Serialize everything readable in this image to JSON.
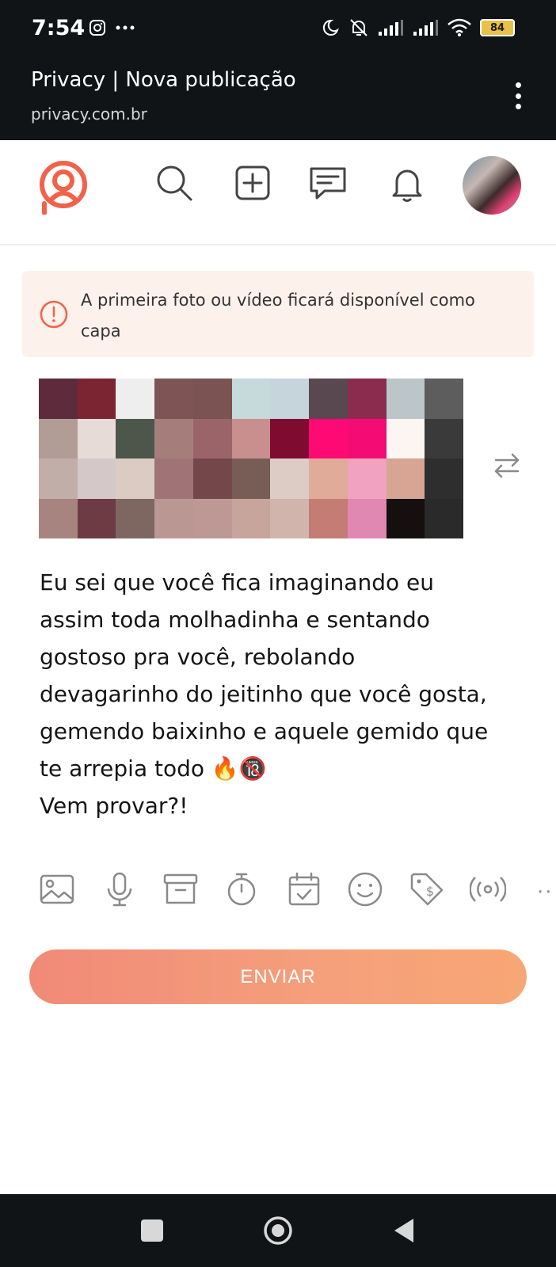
{
  "status_bar": {
    "time": "7:54",
    "battery": "84",
    "icons": [
      "instagram-icon",
      "more-dots-icon",
      "moon-icon",
      "bell-off-icon",
      "signal-icon",
      "signal-icon",
      "wifi-icon",
      "battery-icon"
    ]
  },
  "browser": {
    "title": "Privacy | Nova publicação",
    "url": "privacy.com.br",
    "menu_icon": "more-vertical-icon"
  },
  "header": {
    "logo_icon": "privacy-logo",
    "nav_icons": [
      "search-icon",
      "add-post-icon",
      "messages-icon",
      "notifications-icon"
    ],
    "avatar": "profile-avatar"
  },
  "notice": {
    "icon": "alert-circle-icon",
    "text": "A primeira foto ou vídeo ficará disponível como capa"
  },
  "media": {
    "swap_icon": "swap-arrows-icon",
    "colors": [
      "#5e2b3c",
      "#7a2531",
      "#eeeeee",
      "#7e5554",
      "#7b5352",
      "#c7dadb",
      "#c6d5db",
      "#5a4850",
      "#8b2c4e",
      "#bcc5c8",
      "#5d5d5d",
      "#b19c96",
      "#e6dbd6",
      "#4d564b",
      "#a57e7c",
      "#9a6468",
      "#c98f8f",
      "#7f0b31",
      "#ff0a74",
      "#f40c74",
      "#fbf6f2",
      "#3a3a3a",
      "#c2aea8",
      "#d4c9c8",
      "#dbcbc2",
      "#a07377",
      "#74484a",
      "#785c56",
      "#ddccc6",
      "#e1ab9a",
      "#f0a2c0",
      "#d8a594",
      "#2e2e2e",
      "#a7847f",
      "#6d3b44",
      "#7e6761",
      "#bb9794",
      "#bd9894",
      "#c7a49c",
      "#d1b4ab",
      "#c47c74",
      "#e087b2",
      "#150f10",
      "#2a2a2a"
    ]
  },
  "post": {
    "lines": [
      "Eu sei que você fica imaginando eu",
      "assim toda molhadinha e sentando",
      "gostoso pra você, rebolando",
      "devagarinho do jeitinho que você gosta,",
      "gemendo baixinho e aquele gemido que",
      "te arrepia todo 🔥🔞",
      "Vem provar?!"
    ]
  },
  "toolbar": {
    "icons": [
      "image-icon",
      "microphone-icon",
      "archive-icon",
      "timer-icon",
      "calendar-check-icon",
      "emoji-icon",
      "price-tag-icon",
      "live-broadcast-icon"
    ],
    "more": "··"
  },
  "actions": {
    "send_label": "ENVIAR"
  },
  "nav": {
    "icons": [
      "recent-apps-icon",
      "home-icon",
      "back-icon"
    ]
  },
  "colors": {
    "accent": "#f2614a",
    "send_button": "#f5a07b",
    "notice_bg": "#fdf1ec",
    "dark_bar": "#111417"
  }
}
